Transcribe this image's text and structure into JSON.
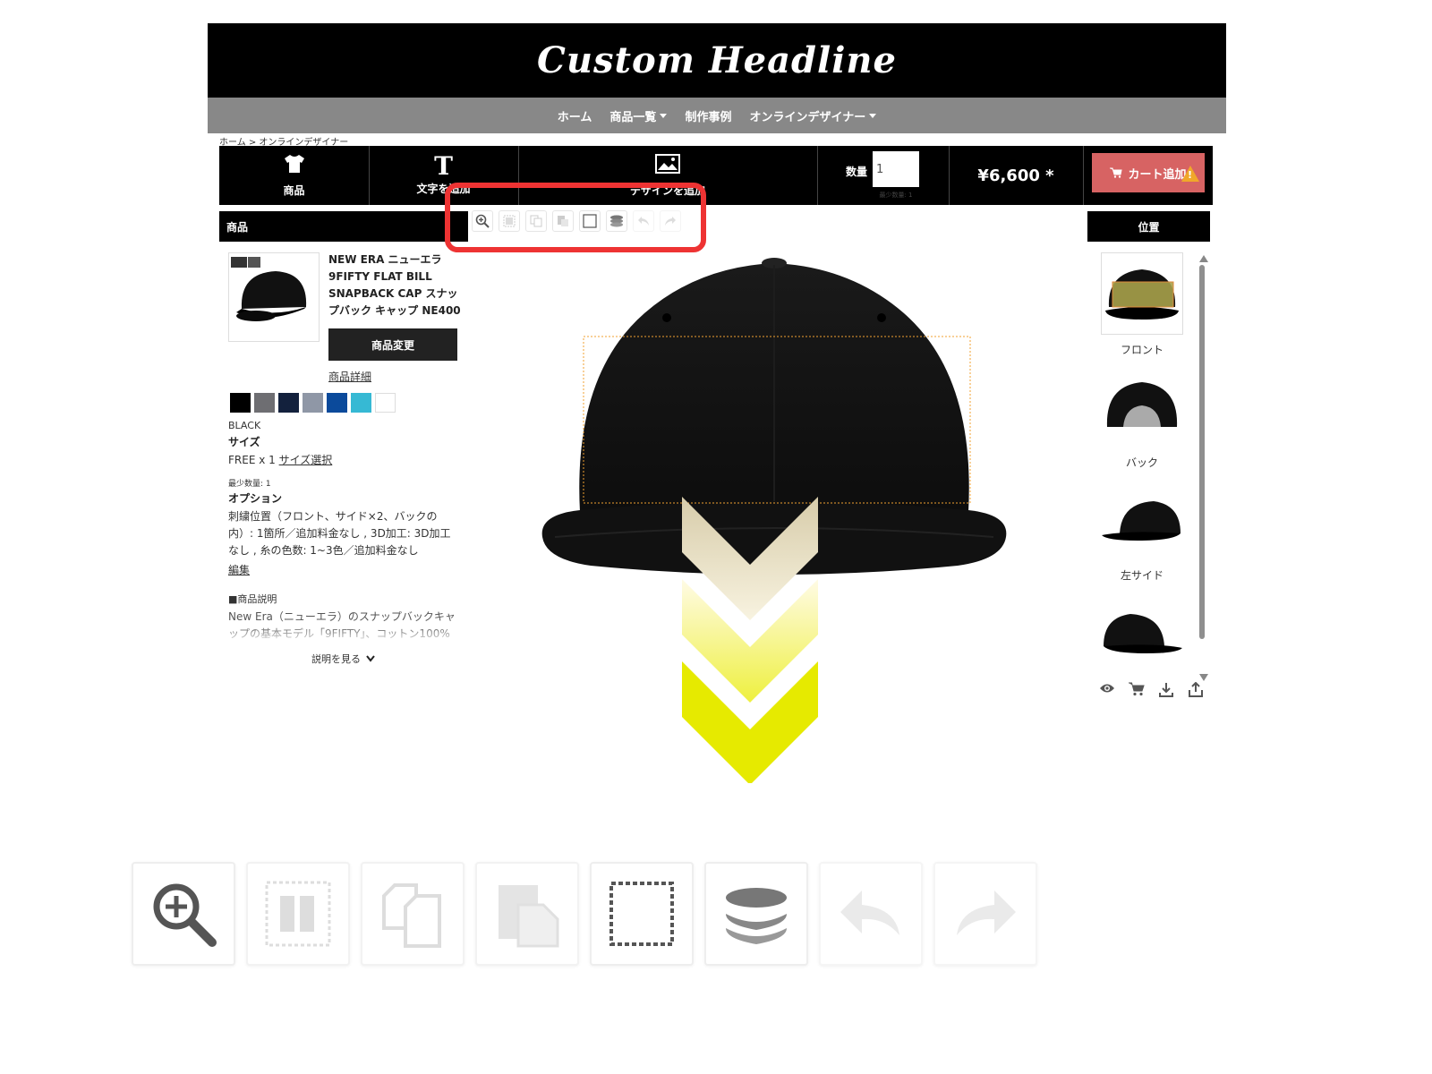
{
  "header": {
    "logo": "Custom Headline"
  },
  "nav": {
    "items": [
      {
        "label": "ホーム",
        "dropdown": false
      },
      {
        "label": "商品一覧",
        "dropdown": true
      },
      {
        "label": "制作事例",
        "dropdown": false
      },
      {
        "label": "オンラインデザイナー",
        "dropdown": true
      }
    ]
  },
  "breadcrumb": "ホーム > オンラインデザイナー",
  "toolbar": {
    "product_label": "商品",
    "add_text_label": "文字を追加",
    "add_design_label": "デザインを追加",
    "qty_label": "数量",
    "qty_value": "1",
    "qty_sub": "最少数量: 1",
    "price": "¥6,600 *",
    "cart_label": "カート追加"
  },
  "left_panel": {
    "heading": "商品",
    "product_title": "NEW ERA ニューエラ 9FIFTY FLAT BILL SNAPBACK CAP スナップバック キャップ NE400",
    "change_button": "商品変更",
    "detail_link": "商品詳細",
    "colors": [
      "#000000",
      "#6e6e72",
      "#13213d",
      "#8f97a6",
      "#0b4a9b",
      "#36b9d4",
      "#ffffff"
    ],
    "selected_color": "BLACK",
    "size_heading": "サイズ",
    "size_value": "FREE x 1",
    "size_link": "サイズ選択",
    "min_qty": "最少数量: 1",
    "option_heading": "オプション",
    "option_text": "刺繍位置（フロント、サイド×2、バックの内）: 1箇所／追加料金なし , 3D加工: 3D加工なし , 糸の色数: 1~3色／追加料金なし",
    "edit_link": "編集",
    "desc_heading": "■商品説明",
    "desc_text": "New Era（ニューエラ）のスナップバックキャップの基本モデル「9FIFTY」、コットン100%",
    "show_more": "説明を見る"
  },
  "right_panel": {
    "heading": "位置",
    "views": [
      {
        "label": "フロント",
        "icon": "cap-front-icon"
      },
      {
        "label": "バック",
        "icon": "cap-back-icon"
      },
      {
        "label": "左サイド",
        "icon": "cap-left-icon"
      },
      {
        "label": "",
        "icon": "cap-right-icon"
      }
    ],
    "bottom_icons": [
      "eye-icon",
      "cart-icon",
      "download-icon",
      "share-icon"
    ]
  },
  "mini_tools": [
    "zoom-in-icon",
    "center-icon",
    "copy-icon",
    "paste-icon",
    "select-icon",
    "layers-icon",
    "undo-icon",
    "redo-icon"
  ],
  "annotation": {
    "frame_color": "#ee3333",
    "arrow_color": "#e6ea00"
  },
  "colors": {
    "accent": "#d76363",
    "nav": "#888888",
    "header": "#000000"
  }
}
